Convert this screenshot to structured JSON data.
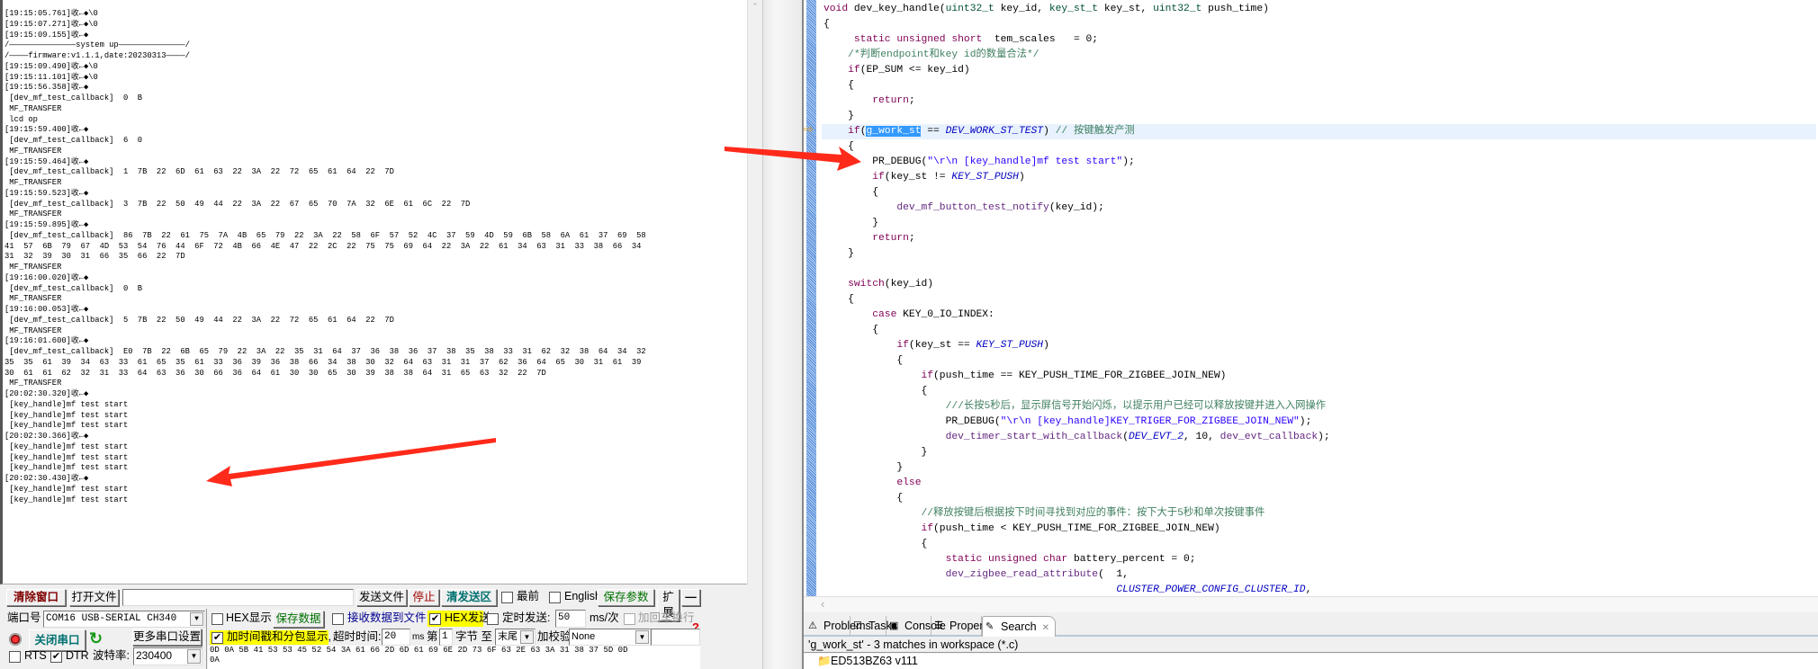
{
  "serial": {
    "log": [
      "[19:15:05.761]收←◆\\0",
      "[19:15:07.271]收←◆\\0",
      "[19:15:09.155]收←◆",
      "/——————————————system up——————————————/",
      "/————firmware:v1.1.1,date:20230313————/",
      "[19:15:09.490]收←◆\\0",
      "[19:15:11.101]收←◆\\0",
      "[19:15:56.358]收←◆",
      " [dev_mf_test_callback]  0  B",
      " MF_TRANSFER",
      " lcd op",
      "[19:15:59.400]收←◆",
      " [dev_mf_test_callback]  6  0",
      " MF_TRANSFER",
      "[19:15:59.464]收←◆",
      " [dev_mf_test_callback]  1  7B  22  6D  61  63  22  3A  22  72  65  61  64  22  7D",
      " MF_TRANSFER",
      "[19:15:59.523]收←◆",
      " [dev_mf_test_callback]  3  7B  22  50  49  44  22  3A  22  67  65  70  7A  32  6E  61  6C  22  7D",
      " MF_TRANSFER",
      "[19:15:59.895]收←◆",
      " [dev_mf_test_callback]  86  7B  22  61  75  7A  4B  65  79  22  3A  22  58  6F  57  52  4C  37  59  4D  59  6B  58  6A  61  37  69  58",
      "41  57  6B  79  67  4D  53  54  76  44  6F  72  4B  66  4E  47  22  2C  22  75  75  69  64  22  3A  22  61  34  63  31  33  38  66  34",
      "31  32  39  30  31  66  35  66  22  7D",
      " MF_TRANSFER",
      "[19:16:00.020]收←◆",
      " [dev_mf_test_callback]  0  B",
      " MF_TRANSFER",
      "[19:16:00.053]收←◆",
      " [dev_mf_test_callback]  5  7B  22  50  49  44  22  3A  22  72  65  61  64  22  7D",
      " MF_TRANSFER",
      "[19:16:01.600]收←◆",
      " [dev_mf_test_callback]  E0  7B  22  6B  65  79  22  3A  22  35  31  64  37  36  38  36  37  38  35  38  33  31  62  32  38  64  34  32",
      "35  35  61  39  34  63  33  61  65  35  61  33  36  39  36  38  66  34  38  30  32  64  63  31  31  37  62  36  64  65  30  31  61  39",
      "30  61  61  62  32  31  33  64  63  36  30  66  36  64  61  30  30  65  30  39  38  38  64  31  65  63  32  22  7D",
      " MF_TRANSFER",
      "[20:02:30.320]收←◆",
      " [key_handle]mf test start",
      " [key_handle]mf test start",
      " [key_handle]mf test start",
      "[20:02:30.366]收←◆",
      " [key_handle]mf test start",
      " [key_handle]mf test start",
      " [key_handle]mf test start",
      "[20:02:30.430]收←◆",
      " [key_handle]mf test start",
      " [key_handle]mf test start"
    ],
    "toolbar": {
      "clear_window": "清除窗口",
      "open_file": "打开文件",
      "file_path": "",
      "send_file": "发送文件",
      "stop": "停止",
      "clear_send": "清发送区",
      "topmost": "最前",
      "topmost_checked": false,
      "english": "English",
      "english_checked": false,
      "save_params": "保存参数",
      "expand": "扩展",
      "collapse": "—"
    },
    "port_label": "端口号",
    "port_value": "COM16 USB-SERIAL CH340",
    "close_port": "关闭串口",
    "more_settings": "更多串口设置",
    "rts": "RTS",
    "rts_checked": false,
    "dtr": "DTR",
    "dtr_checked": true,
    "baud_label": "波特率:",
    "baud_value": "230400",
    "hex_display": "HEX显示",
    "hex_display_checked": false,
    "save_data": "保存数据",
    "recv_to_file": "接收数据到文件",
    "recv_to_file_checked": false,
    "hex_send": "HEX发送",
    "hex_send_checked": true,
    "timed_send": "定时发送:",
    "timed_send_checked": false,
    "interval": "50",
    "interval_unit": "ms/次",
    "add_crlf": "加回车换行",
    "add_crlf_checked": false,
    "timestamp": "加时间戳和分包显示,",
    "timestamp_checked": true,
    "timeout_label": "超时时间:",
    "timeout_value": "20",
    "timeout_unit": "ms",
    "nth_label": "第",
    "nth_value": "1",
    "byte_to": "字节 至",
    "end_value": "末尾",
    "checksum_label": "加校验",
    "checksum_value": "None",
    "help": "?",
    "send_text": "0D 0A 5B 41 53 53 45 52 54 3A 61 66 2D 6D 61 69 6E 2D 73 6F 63 2E 63 3A 31 38 37 5D 0D\n0A"
  },
  "editor": {
    "lines": [
      [
        {
          "t": "void",
          "c": "kw"
        },
        {
          "t": " dev_key_handle(",
          "c": "pl"
        },
        {
          "t": "uint32_t",
          "c": "ty"
        },
        {
          "t": " key_id, ",
          "c": "pl"
        },
        {
          "t": "key_st_t",
          "c": "ty"
        },
        {
          "t": " key_st, ",
          "c": "pl"
        },
        {
          "t": "uint32_t",
          "c": "ty"
        },
        {
          "t": " push_time)",
          "c": "pl"
        }
      ],
      [
        {
          "t": "{",
          "c": "pl"
        }
      ],
      [
        {
          "t": "     static unsigned short",
          "c": "kw"
        },
        {
          "t": "  tem_scales   = 0;",
          "c": "pl"
        }
      ],
      [
        {
          "t": "    /*判断endpoint和key id的数量合法*/",
          "c": "cm"
        }
      ],
      [
        {
          "t": "    if",
          "c": "kw"
        },
        {
          "t": "(EP_SUM <= key_id)",
          "c": "pl"
        }
      ],
      [
        {
          "t": "    {",
          "c": "pl"
        }
      ],
      [
        {
          "t": "        return",
          "c": "kw"
        },
        {
          "t": ";",
          "c": "pl"
        }
      ],
      [
        {
          "t": "    }",
          "c": "pl"
        }
      ],
      [
        {
          "t": "    if",
          "c": "kw"
        },
        {
          "t": "(",
          "c": "pl"
        },
        {
          "t": "g_work_st",
          "c": "sel"
        },
        {
          "t": " == ",
          "c": "pl"
        },
        {
          "t": "DEV_WORK_ST_TEST",
          "c": "mac"
        },
        {
          "t": ") ",
          "c": "pl"
        },
        {
          "t": "// 按键触发产测",
          "c": "cm"
        }
      ],
      [
        {
          "t": "    {",
          "c": "pl"
        }
      ],
      [
        {
          "t": "        PR_DEBUG(",
          "c": "pl"
        },
        {
          "t": "\"\\r\\n [key_handle]mf test start\"",
          "c": "str"
        },
        {
          "t": ");",
          "c": "pl"
        }
      ],
      [
        {
          "t": "        if",
          "c": "kw"
        },
        {
          "t": "(key_st != ",
          "c": "pl"
        },
        {
          "t": "KEY_ST_PUSH",
          "c": "mac"
        },
        {
          "t": ")",
          "c": "pl"
        }
      ],
      [
        {
          "t": "        {",
          "c": "pl"
        }
      ],
      [
        {
          "t": "            dev_mf_button_test_notify",
          "c": "fn"
        },
        {
          "t": "(key_id);",
          "c": "pl"
        }
      ],
      [
        {
          "t": "        }",
          "c": "pl"
        }
      ],
      [
        {
          "t": "        return",
          "c": "kw"
        },
        {
          "t": ";",
          "c": "pl"
        }
      ],
      [
        {
          "t": "    }",
          "c": "pl"
        }
      ],
      [
        {
          "t": "",
          "c": "pl"
        }
      ],
      [
        {
          "t": "    switch",
          "c": "kw"
        },
        {
          "t": "(key_id)",
          "c": "pl"
        }
      ],
      [
        {
          "t": "    {",
          "c": "pl"
        }
      ],
      [
        {
          "t": "        case",
          "c": "kw"
        },
        {
          "t": " KEY_0_IO_INDEX:",
          "c": "pl"
        }
      ],
      [
        {
          "t": "        {",
          "c": "pl"
        }
      ],
      [
        {
          "t": "            if",
          "c": "kw"
        },
        {
          "t": "(key_st == ",
          "c": "pl"
        },
        {
          "t": "KEY_ST_PUSH",
          "c": "mac"
        },
        {
          "t": ")",
          "c": "pl"
        }
      ],
      [
        {
          "t": "            {",
          "c": "pl"
        }
      ],
      [
        {
          "t": "                if",
          "c": "kw"
        },
        {
          "t": "(push_time == KEY_PUSH_TIME_FOR_ZIGBEE_JOIN_NEW)",
          "c": "pl"
        }
      ],
      [
        {
          "t": "                {",
          "c": "pl"
        }
      ],
      [
        {
          "t": "                    ///长按5秒后，显示屏信号开始闪烁，以提示用户已经可以释放按键并进入入网操作",
          "c": "cm"
        }
      ],
      [
        {
          "t": "                    PR_DEBUG(",
          "c": "pl"
        },
        {
          "t": "\"\\r\\n [key_handle]KEY_TRIGER_FOR_ZIGBEE_JOIN_NEW\"",
          "c": "str"
        },
        {
          "t": ");",
          "c": "pl"
        }
      ],
      [
        {
          "t": "                    dev_timer_start_with_callback",
          "c": "fn"
        },
        {
          "t": "(",
          "c": "pl"
        },
        {
          "t": "DEV_EVT_2",
          "c": "mac"
        },
        {
          "t": ", 10, ",
          "c": "pl"
        },
        {
          "t": "dev_evt_callback",
          "c": "fn"
        },
        {
          "t": ");",
          "c": "pl"
        }
      ],
      [
        {
          "t": "                }",
          "c": "pl"
        }
      ],
      [
        {
          "t": "            }",
          "c": "pl"
        }
      ],
      [
        {
          "t": "            else",
          "c": "kw"
        }
      ],
      [
        {
          "t": "            {",
          "c": "pl"
        }
      ],
      [
        {
          "t": "                //释放按键后根据按下时间寻找到对应的事件：按下大于5秒和单次按键事件",
          "c": "cm"
        }
      ],
      [
        {
          "t": "                if",
          "c": "kw"
        },
        {
          "t": "(push_time < KEY_PUSH_TIME_FOR_ZIGBEE_JOIN_NEW)",
          "c": "pl"
        }
      ],
      [
        {
          "t": "                {",
          "c": "pl"
        }
      ],
      [
        {
          "t": "                    static unsigned char",
          "c": "kw"
        },
        {
          "t": " battery_percent = 0;",
          "c": "pl"
        }
      ],
      [
        {
          "t": "                    dev_zigbee_read_attribute",
          "c": "fn"
        },
        {
          "t": "(  1,",
          "c": "pl"
        }
      ],
      [
        {
          "t": "                                                ",
          "c": "pl"
        },
        {
          "t": "CLUSTER_POWER_CONFIG_CLUSTER_ID",
          "c": "mac"
        },
        {
          "t": ",",
          "c": "pl"
        }
      ]
    ],
    "current_line": 8
  },
  "bottom": {
    "tabs": [
      {
        "label": "Problems",
        "icon": "problems-icon",
        "glyph": "⚠"
      },
      {
        "label": "Tasks",
        "icon": "tasks-icon",
        "glyph": "☑"
      },
      {
        "label": "Console",
        "icon": "console-icon",
        "glyph": "▣"
      },
      {
        "label": "Properties",
        "icon": "properties-icon",
        "glyph": "☰"
      },
      {
        "label": "Search",
        "icon": "search-icon",
        "glyph": "✎",
        "active": true
      }
    ],
    "close": "✕",
    "summary": "'g_work_st' - 3 matches in workspace (*.c)",
    "tree_item": "ED513BZ63 v111"
  },
  "colors": {
    "annotation_arrow": "#ff2a1a",
    "keyword": "#7f0055",
    "macro": "#0000c0",
    "comment": "#3f7f5f",
    "string": "#2a00ff",
    "selection": "#3399ff",
    "highlight": "#ffff00"
  }
}
